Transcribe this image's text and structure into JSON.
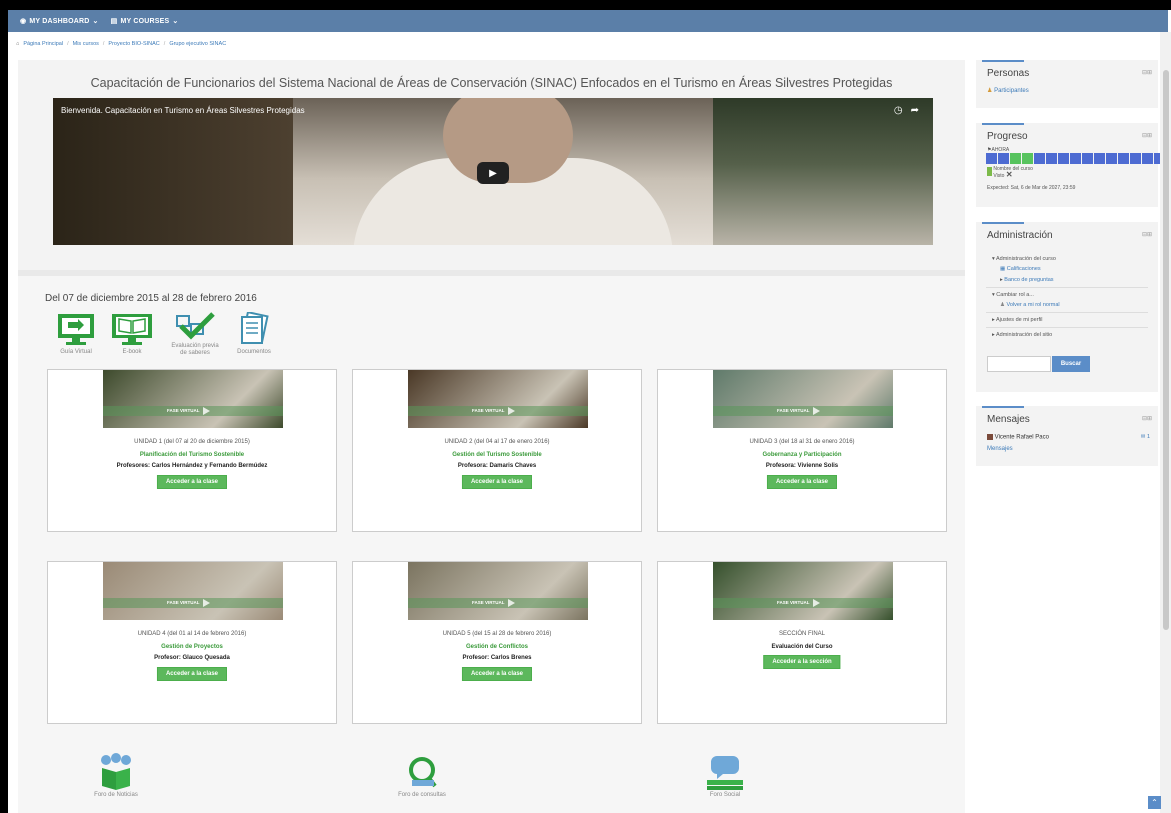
{
  "nav": {
    "dashboard": "MY DASHBOARD",
    "courses": "MY COURSES"
  },
  "breadcrumb": [
    "Página Principal",
    "Mis cursos",
    "Proyecto BIO-SINAC",
    "Grupo ejecutivo SINAC"
  ],
  "course_title": "Capacitación de Funcionarios del Sistema Nacional de Áreas de Conservación (SINAC) Enfocados en el Turismo en Áreas Silvestres Protegidas",
  "video": {
    "title": "Bienvenida. Capacitación en Turismo en Áreas Silvestres Protegidas"
  },
  "date_range": "Del 07 de diciembre 2015 al 28 de febrero 2016",
  "tools": [
    {
      "label": "Guía Virtual",
      "icon": "monitor-icon"
    },
    {
      "label": "E-book",
      "icon": "ebook-icon"
    },
    {
      "label": "Evaluación previa de saberes",
      "icon": "checklist-icon"
    },
    {
      "label": "Documentos",
      "icon": "documents-icon"
    }
  ],
  "badge_label": "FASE VIRTUAL",
  "units": [
    {
      "unit": "UNIDAD 1 (del 07 al 20 de diciembre 2015)",
      "topic": "Planificación del Turismo Sostenible",
      "prof": "Profesores: Carlos Hernández y Fernando Bermúdez",
      "button": "Acceder a la clase",
      "img_color": "#3d4a2c"
    },
    {
      "unit": "UNIDAD 2 (del 04 al 17 de enero 2016)",
      "topic": "Gestión del Turismo Sostenible",
      "prof": "Profesora: Damaris Chaves",
      "button": "Acceder a la clase",
      "img_color": "#4a3826"
    },
    {
      "unit": "UNIDAD 3 (del 18 al 31 de enero 2016)",
      "topic": "Gobernanza y Participación",
      "prof": "Profesora: Vivienne Solis",
      "button": "Acceder a la clase",
      "img_color": "#5f7a6a"
    },
    {
      "unit": "UNIDAD 4 (del 01 al 14 de febrero 2016)",
      "topic": "Gestión de Proyectos",
      "prof": "Profesor: Glauco Quesada",
      "button": "Acceder a la clase",
      "img_color": "#9a8a76"
    },
    {
      "unit": "UNIDAD 5 (del 15 al 28 de febrero 2016)",
      "topic": "Gestión de Conflictos",
      "prof": "Profesor: Carlos Brenes",
      "button": "Acceder a la clase",
      "img_color": "#7b7460"
    },
    {
      "unit": "SECCIÓN FINAL",
      "topic": "Evaluación del Curso",
      "prof": "",
      "button": "Acceder a la sección",
      "img_color": "#35502c"
    }
  ],
  "forums": [
    {
      "label": "Foro de Noticias",
      "icon": "news-forum-icon"
    },
    {
      "label": "Foro de consultas",
      "icon": "questions-forum-icon"
    },
    {
      "label": "Foro Social",
      "icon": "social-forum-icon"
    }
  ],
  "sidebar": {
    "personas": {
      "title": "Personas",
      "link": "Participantes"
    },
    "progreso": {
      "title": "Progreso",
      "now": "AHORA",
      "legend1": "Nombre del curso",
      "legend2": "Visto",
      "expected": "Expected: Sat, 6 de Mar de 2027, 23:59",
      "squares": [
        "#4d6bd2",
        "#4d6bd2",
        "#57c35e",
        "#57c35e",
        "#4d6bd2",
        "#4d6bd2",
        "#4d6bd2",
        "#4d6bd2",
        "#4d6bd2",
        "#4d6bd2",
        "#4d6bd2",
        "#4d6bd2",
        "#4d6bd2",
        "#4d6bd2",
        "#4d6bd2"
      ]
    },
    "admin": {
      "title": "Administración",
      "course_admin": "Administración del curso",
      "grades": "Calificaciones",
      "question_bank": "Banco de preguntas",
      "switch_role": "Cambiar rol a...",
      "back_role": "Volver a mi rol normal",
      "profile_settings": "Ajustes de mi perfil",
      "site_admin": "Administración del sitio",
      "search_button": "Buscar"
    },
    "mensajes": {
      "title": "Mensajes",
      "contact": "Vicente Rafael Paco",
      "count": "1",
      "link": "Mensajes"
    }
  }
}
